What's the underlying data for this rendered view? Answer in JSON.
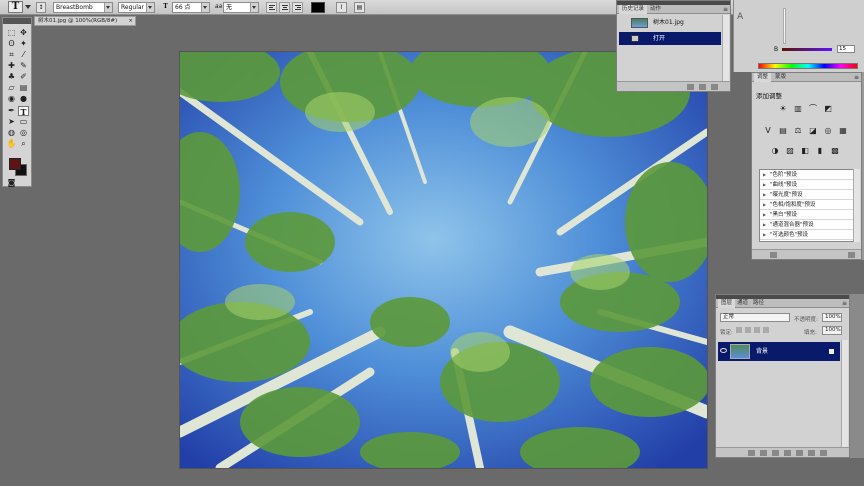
{
  "options_bar": {
    "tool_icon": "T",
    "font_family": "BreastBomb",
    "font_style": "Regular",
    "size_prefix": "T",
    "font_size": "66 点",
    "aa_prefix": "aa",
    "anti_alias": "无",
    "text_color": "#000000"
  },
  "document": {
    "tab_title": "树木01.jpg @ 100%(RGB/8#)",
    "close_glyph": "×"
  },
  "toolbox": {
    "text_tool_glyph": "T",
    "foreground_color": "#5c1414",
    "background_color": "#111111"
  },
  "history_panel": {
    "tabs": [
      "历史记录",
      "动作"
    ],
    "snapshot_label": "树木01.jpg",
    "states": [
      "打开"
    ]
  },
  "color_panel": {
    "partial_label": "A",
    "channel_b_label": "B",
    "channel_b_value": "15"
  },
  "adjustments_panel": {
    "tabs": [
      "调整",
      "蒙版"
    ],
    "title": "添加调整",
    "presets": [
      "\"色阶\"预设",
      "\"曲线\"预设",
      "\"曝光度\"预设",
      "\"色相/饱和度\"预设",
      "\"黑白\"预设",
      "\"通道混合器\"预设",
      "\"可选颜色\"预设"
    ]
  },
  "layers_panel": {
    "tabs": [
      "图层",
      "通道",
      "路径"
    ],
    "blend_mode": "正常",
    "opacity_label": "不透明度:",
    "opacity_value": "100%",
    "lock_label": "锁定:",
    "fill_label": "填充:",
    "fill_value": "100%",
    "layer_name": "背景"
  }
}
